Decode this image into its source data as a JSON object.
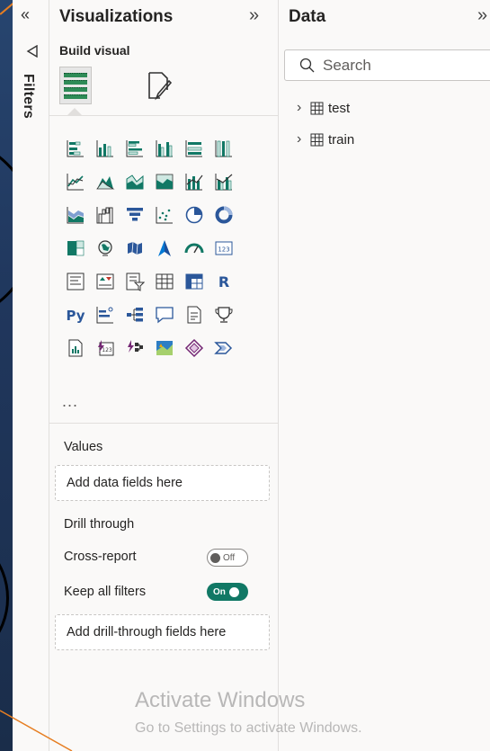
{
  "filters": {
    "label": "Filters",
    "expand_icon": "double-chevron-left-icon"
  },
  "visualizations": {
    "title": "Visualizations",
    "collapse_icon": "double-chevron-right-icon",
    "build_visual_label": "Build visual",
    "more_label": "...",
    "values_label": "Values",
    "values_placeholder": "Add data fields here",
    "drill_through_label": "Drill through",
    "cross_report_label": "Cross-report",
    "cross_report_toggle": "Off",
    "keep_filters_label": "Keep all filters",
    "keep_filters_toggle": "On",
    "drill_placeholder": "Add drill-through fields here",
    "visual_icons": [
      "stacked-bar-chart-icon",
      "stacked-column-chart-icon",
      "clustered-bar-chart-icon",
      "clustered-column-chart-icon",
      "100-stacked-bar-chart-icon",
      "100-stacked-column-chart-icon",
      "line-chart-icon",
      "area-chart-icon",
      "stacked-area-chart-icon",
      "100-stacked-area-chart-icon",
      "line-and-stacked-column-chart-icon",
      "line-and-clustered-column-chart-icon",
      "ribbon-chart-icon",
      "waterfall-chart-icon",
      "funnel-chart-icon",
      "scatter-chart-icon",
      "pie-chart-icon",
      "donut-chart-icon",
      "treemap-icon",
      "map-icon",
      "filled-map-icon",
      "azure-map-icon",
      "gauge-icon",
      "card-icon",
      "multi-row-card-icon",
      "kpi-icon",
      "slicer-icon",
      "table-icon",
      "matrix-icon",
      "r-visual-icon",
      "python-visual-icon",
      "key-influencers-icon",
      "decomposition-tree-icon",
      "qa-icon",
      "smart-narrative-icon",
      "metrics-icon",
      "paginated-report-icon",
      "power-apps-icon",
      "power-automate-icon",
      "arcgis-map-icon",
      "diamond-visual-icon",
      "chevron-visual-icon"
    ]
  },
  "data": {
    "title": "Data",
    "collapse_icon": "double-chevron-right-icon",
    "search_placeholder": "Search",
    "tables": [
      "test",
      "train"
    ]
  },
  "watermark": {
    "line1": "Activate Windows",
    "line2": "Go to Settings to activate Windows."
  },
  "colors": {
    "pane_background": "#faf9f8",
    "icon_teal": "#117865",
    "icon_blue": "#2b579a",
    "toggle_on": "#117865",
    "canvas_dark": "#20375d"
  }
}
